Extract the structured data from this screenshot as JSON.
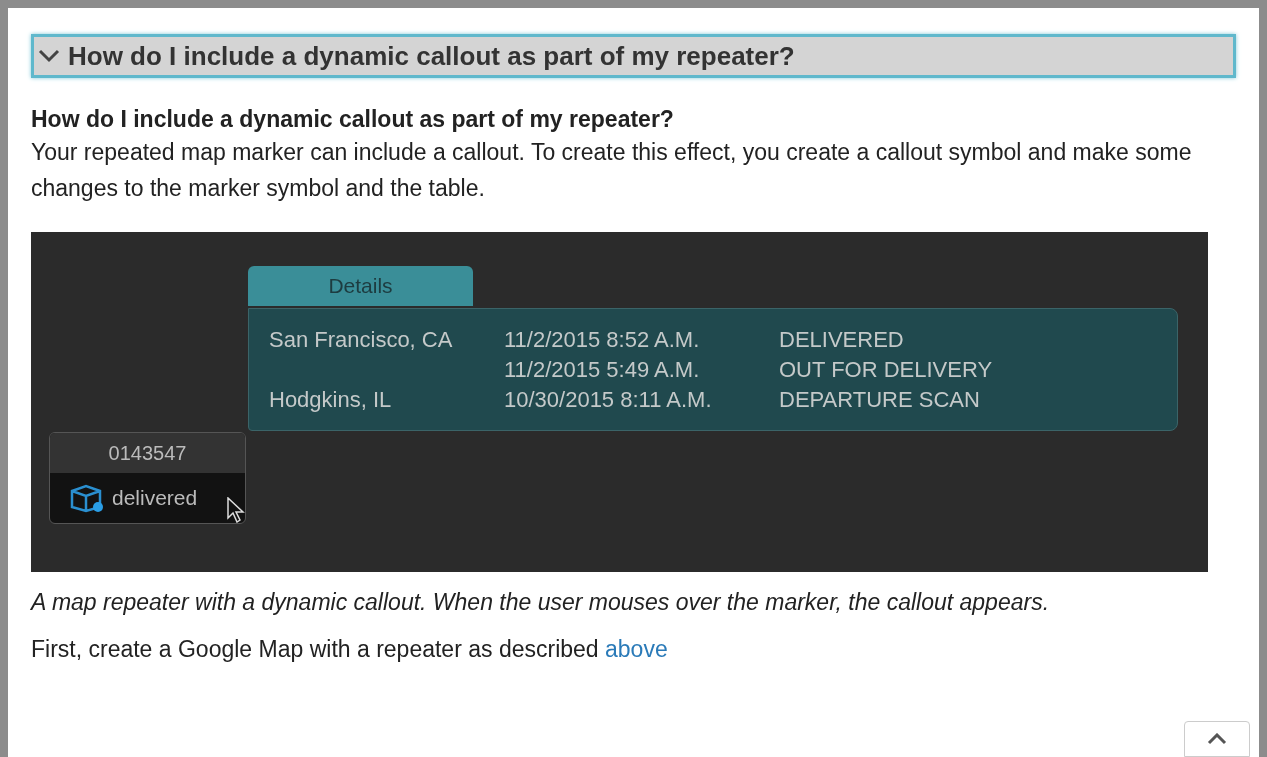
{
  "accordion": {
    "title": "How do I include a dynamic callout as part of my repeater?",
    "expanded": true
  },
  "heading": "How do I include a dynamic callout as part of my repeater?",
  "paragraph": "Your repeated map marker can include a callout. To create this effect, you create a callout symbol and make some changes to the marker symbol and the table.",
  "figure": {
    "callout": {
      "tab": "Details",
      "rows": [
        {
          "location": "San Francisco, CA",
          "time": "11/2/2015 8:52 A.M.",
          "status": "DELIVERED"
        },
        {
          "time": "11/2/2015 5:49 A.M.",
          "status": "OUT FOR DELIVERY"
        },
        {
          "location": "Hodgkins, IL",
          "time": "10/30/2015 8:11 A.M.",
          "status": "DEPARTURE SCAN"
        }
      ]
    },
    "marker": {
      "id": "0143547",
      "status": "delivered"
    }
  },
  "caption": "A map repeater with a dynamic callout. When the user mouses over the marker, the callout appears.",
  "next_paragraph": {
    "text": "First, create a Google Map with a repeater as described",
    "link": "above"
  }
}
